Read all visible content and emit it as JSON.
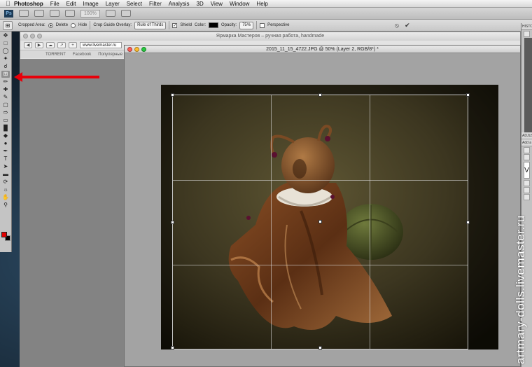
{
  "menubar": {
    "app_name": "Photoshop",
    "items": [
      "File",
      "Edit",
      "Image",
      "Layer",
      "Select",
      "Filter",
      "Analysis",
      "3D",
      "View",
      "Window",
      "Help"
    ]
  },
  "appbar": {
    "logo": "Ps",
    "zoom": "100%"
  },
  "options_bar": {
    "cropped_area_label": "Cropped Area:",
    "delete_label": "Delete",
    "hide_label": "Hide",
    "overlay_label": "Crop Guide Overlay:",
    "overlay_value": "Rule of Thirds",
    "shield_label": "Shield",
    "color_label": "Color:",
    "shield_color": "#000000",
    "opacity_label": "Opacity:",
    "opacity_value": "75%",
    "perspective_label": "Perspective",
    "cancel_icon": "⦸",
    "commit_icon": "✔"
  },
  "browser": {
    "title": "Ярмарка Мастеров – ручная работа, handmade",
    "url": "www.livemaster.ru",
    "bookmarks": [
      "TORRENT",
      "Facebook",
      "Популярные"
    ]
  },
  "document": {
    "title": "2015_11_15_4722.JPG @ 50% (Layer 2, RGB/8*) *"
  },
  "tools": {
    "icons": [
      "move",
      "marquee",
      "lasso",
      "quick-select",
      "crop",
      "eyedropper",
      "spot-heal",
      "brush",
      "stamp",
      "history-brush",
      "eraser",
      "gradient",
      "dodge",
      "pen",
      "type",
      "path-select",
      "shape",
      "3d-rotate",
      "3d-orbit",
      "hand",
      "zoom"
    ],
    "active_tool": "crop",
    "foreground_color": "#e00000",
    "background_color": "#000000"
  },
  "right_panel": {
    "history_header": "HISTO",
    "adjust_header": "ADJUS",
    "add_adjust": "Add a",
    "panel_glyph": "V"
  },
  "watermark": "artmary-dolls.livemaster.ru",
  "colors": {
    "arrow": "#e8000a",
    "accent": "#e00000"
  }
}
